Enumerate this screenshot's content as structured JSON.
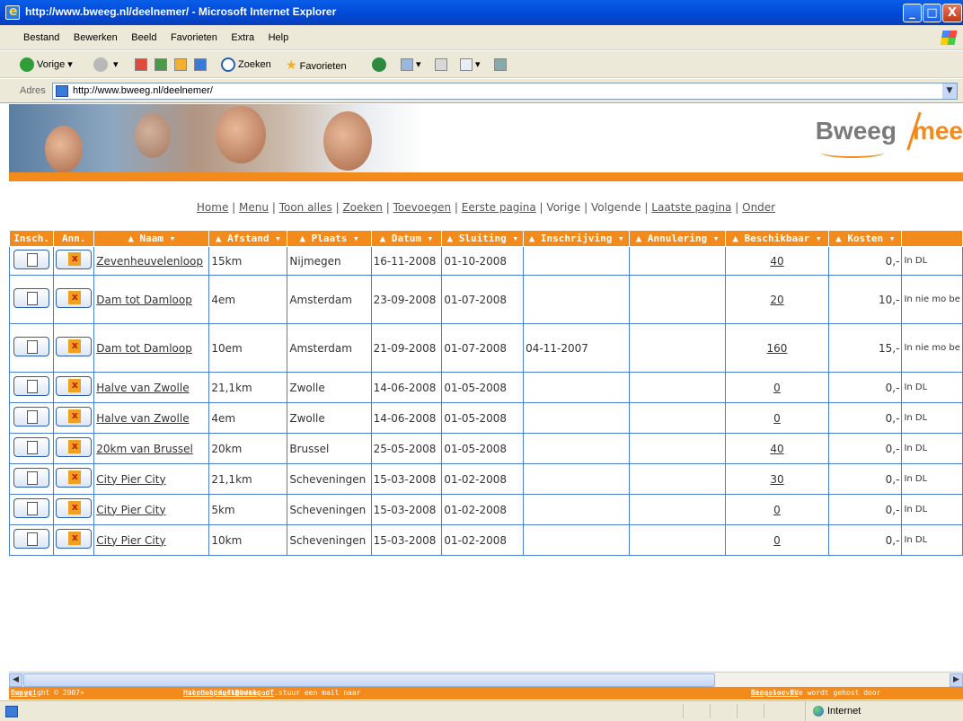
{
  "window": {
    "title": "http://www.bweeg.nl/deelnemer/ - Microsoft Internet Explorer",
    "min": "_",
    "max": "□",
    "close": "X"
  },
  "menu": [
    "Bestand",
    "Bewerken",
    "Beeld",
    "Favorieten",
    "Extra",
    "Help"
  ],
  "toolbar": {
    "back": "Vorige",
    "search": "Zoeken",
    "favorites": "Favorieten"
  },
  "address": {
    "label": "Adres",
    "url": "http://www.bweeg.nl/deelnemer/"
  },
  "logo": {
    "bweeg": "Bweeg",
    "mee": "mee"
  },
  "nav": {
    "home": "Home",
    "menu": "Menu",
    "toon_alles": "Toon alles",
    "zoeken": "Zoeken",
    "toevoegen": "Toevoegen",
    "eerste": "Eerste pagina",
    "vorige": "Vorige",
    "volgende": "Volgende",
    "laatste": "Laatste pagina",
    "onder": "Onder",
    "sep": "|"
  },
  "table": {
    "headers": [
      "Insch.",
      "Ann.",
      "▲ Naam ▾",
      "▲ Afstand ▾",
      "▲ Plaats ▾",
      "▲ Datum ▾",
      "▲ Sluiting ▾",
      "▲ Inschrijving ▾",
      "▲ Annulering ▾",
      "▲ Beschikbaar ▾",
      "▲ Kosten ▾",
      ""
    ],
    "rows": [
      {
        "naam": "Zevenheuvelenloop",
        "afstand": "15km",
        "plaats": "Nijmegen",
        "datum": "16-11-2008",
        "sluiting": "01-10-2008",
        "inschrijving": "",
        "annulering": "",
        "beschikbaar": "40",
        "kosten": "0,-",
        "info": "In DL"
      },
      {
        "naam": "Dam tot Damloop",
        "afstand": "4em",
        "plaats": "Amsterdam",
        "datum": "23-09-2008",
        "sluiting": "01-07-2008",
        "inschrijving": "",
        "annulering": "",
        "beschikbaar": "20",
        "kosten": "10,-",
        "info": "In nie mo be"
      },
      {
        "naam": "Dam tot Damloop",
        "afstand": "10em",
        "plaats": "Amsterdam",
        "datum": "21-09-2008",
        "sluiting": "01-07-2008",
        "inschrijving": "04-11-2007",
        "annulering": "",
        "beschikbaar": "160",
        "kosten": "15,-",
        "info": "In nie mo be"
      },
      {
        "naam": "Halve van Zwolle",
        "afstand": "21,1km",
        "plaats": "Zwolle",
        "datum": "14-06-2008",
        "sluiting": "01-05-2008",
        "inschrijving": "",
        "annulering": "",
        "beschikbaar": "0",
        "kosten": "0,-",
        "info": "In DL"
      },
      {
        "naam": "Halve van Zwolle",
        "afstand": "4em",
        "plaats": "Zwolle",
        "datum": "14-06-2008",
        "sluiting": "01-05-2008",
        "inschrijving": "",
        "annulering": "",
        "beschikbaar": "0",
        "kosten": "0,-",
        "info": "In DL"
      },
      {
        "naam": "20km van Brussel",
        "afstand": "20km",
        "plaats": "Brussel",
        "datum": "25-05-2008",
        "sluiting": "01-05-2008",
        "inschrijving": "",
        "annulering": "",
        "beschikbaar": "40",
        "kosten": "0,-",
        "info": "In DL"
      },
      {
        "naam": "City Pier City",
        "afstand": "21,1km",
        "plaats": "Scheveningen",
        "datum": "15-03-2008",
        "sluiting": "01-02-2008",
        "inschrijving": "",
        "annulering": "",
        "beschikbaar": "30",
        "kosten": "0,-",
        "info": "In DL"
      },
      {
        "naam": "City Pier City",
        "afstand": "5km",
        "plaats": "Scheveningen",
        "datum": "15-03-2008",
        "sluiting": "01-02-2008",
        "inschrijving": "",
        "annulering": "",
        "beschikbaar": "0",
        "kosten": "0,-",
        "info": "In DL"
      },
      {
        "naam": "City Pier City",
        "afstand": "10km",
        "plaats": "Scheveningen",
        "datum": "15-03-2008",
        "sluiting": "01-02-2008",
        "inschrijving": "",
        "annulering": "",
        "beschikbaar": "0",
        "kosten": "0,-",
        "info": "In DL"
      }
    ]
  },
  "footer": {
    "copyright": "Copyright © 2007+ ",
    "copyright_link": "Bweeg!",
    "help_pre": "Hulp nodig? Download ",
    "help_link": "hier",
    "help_mid": " de handleiding of stuur een mail naar ",
    "help_mail": "helpdesk@bweeg.nl",
    "help_end": ".",
    "hosted_pre": "Deze service wordt gehost door ",
    "hosted_link": "Ningaloo BV"
  },
  "status": {
    "zone": "Internet"
  },
  "colors": {
    "accent": "#f28a1c",
    "titlebar": "#0047d6",
    "cell_border": "#4a7fd4"
  }
}
